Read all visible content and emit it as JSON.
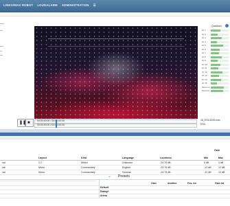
{
  "nav": {
    "items": [
      "LINKS/MAX ROBOT",
      "LOUDALARM",
      "ADMINISTRATION",
      "☰"
    ]
  },
  "meters": {
    "header": "Quadrant",
    "badge": "1",
    "rows": [
      {
        "label": "ch 1",
        "level": 0.55
      },
      {
        "label": "ch 2",
        "level": 0.4
      },
      {
        "label": "ch 3",
        "level": 0.62
      },
      {
        "label": "ch 4",
        "level": 0.35
      },
      {
        "label": "ch 5",
        "level": 0.7
      },
      {
        "label": "ch 6",
        "level": 0.5
      },
      {
        "label": "ch 7",
        "level": 0.45
      },
      {
        "label": "ch 8",
        "level": 0.6
      },
      {
        "label": "ch 9",
        "level": 0.38
      },
      {
        "label": "ch 10",
        "level": 0.52
      },
      {
        "label": "ch 11",
        "level": 0.42
      },
      {
        "label": "ch 12",
        "level": 0.66
      },
      {
        "label": "ch 13",
        "level": 0.48
      },
      {
        "label": "ch 14",
        "level": 0.58
      },
      {
        "label": "ch 15",
        "level": 0.36
      },
      {
        "label": "stereo a",
        "level": 0.72
      },
      {
        "label": "stereo b",
        "level": 0.7
      }
    ]
  },
  "transport": {
    "time1": "00:00:00:00 / 00:00:00:00",
    "time2": "00:00:00:00 / 00:00:00:00",
    "file_name": "15_ESC2019.mxv",
    "file_meta": "ESC"
  },
  "audio_table": {
    "gain_header": "Gain",
    "headers": [
      "",
      "Layout",
      "Kind",
      "Language",
      "Loudness",
      "",
      "Min",
      "Max"
    ],
    "rows": [
      [
        "nal",
        "2.1",
        "Mixed",
        "Unknown",
        "-24.75 dB",
        "",
        "0 dB",
        "0 dB"
      ],
      [
        "nal",
        "Mono",
        "Commentary",
        "English",
        "-23.75 dB",
        "",
        "-12 dB",
        "12 dB"
      ],
      [
        "nal",
        "Mono",
        "Commentary",
        "German",
        "-24.75 dB",
        "",
        "-12 dB",
        "12 dB"
      ]
    ]
  },
  "presets": {
    "title": "Presets",
    "headers": [
      "",
      "Gain",
      "Another",
      "Pos. Int.",
      "Gain Int."
    ],
    "rows": [
      "Default",
      "Dialog+",
      "Arena"
    ]
  },
  "colors": {
    "nav": "#3b6a94",
    "accent": "#3d79b4",
    "meter_fill": "#7fc77f"
  }
}
